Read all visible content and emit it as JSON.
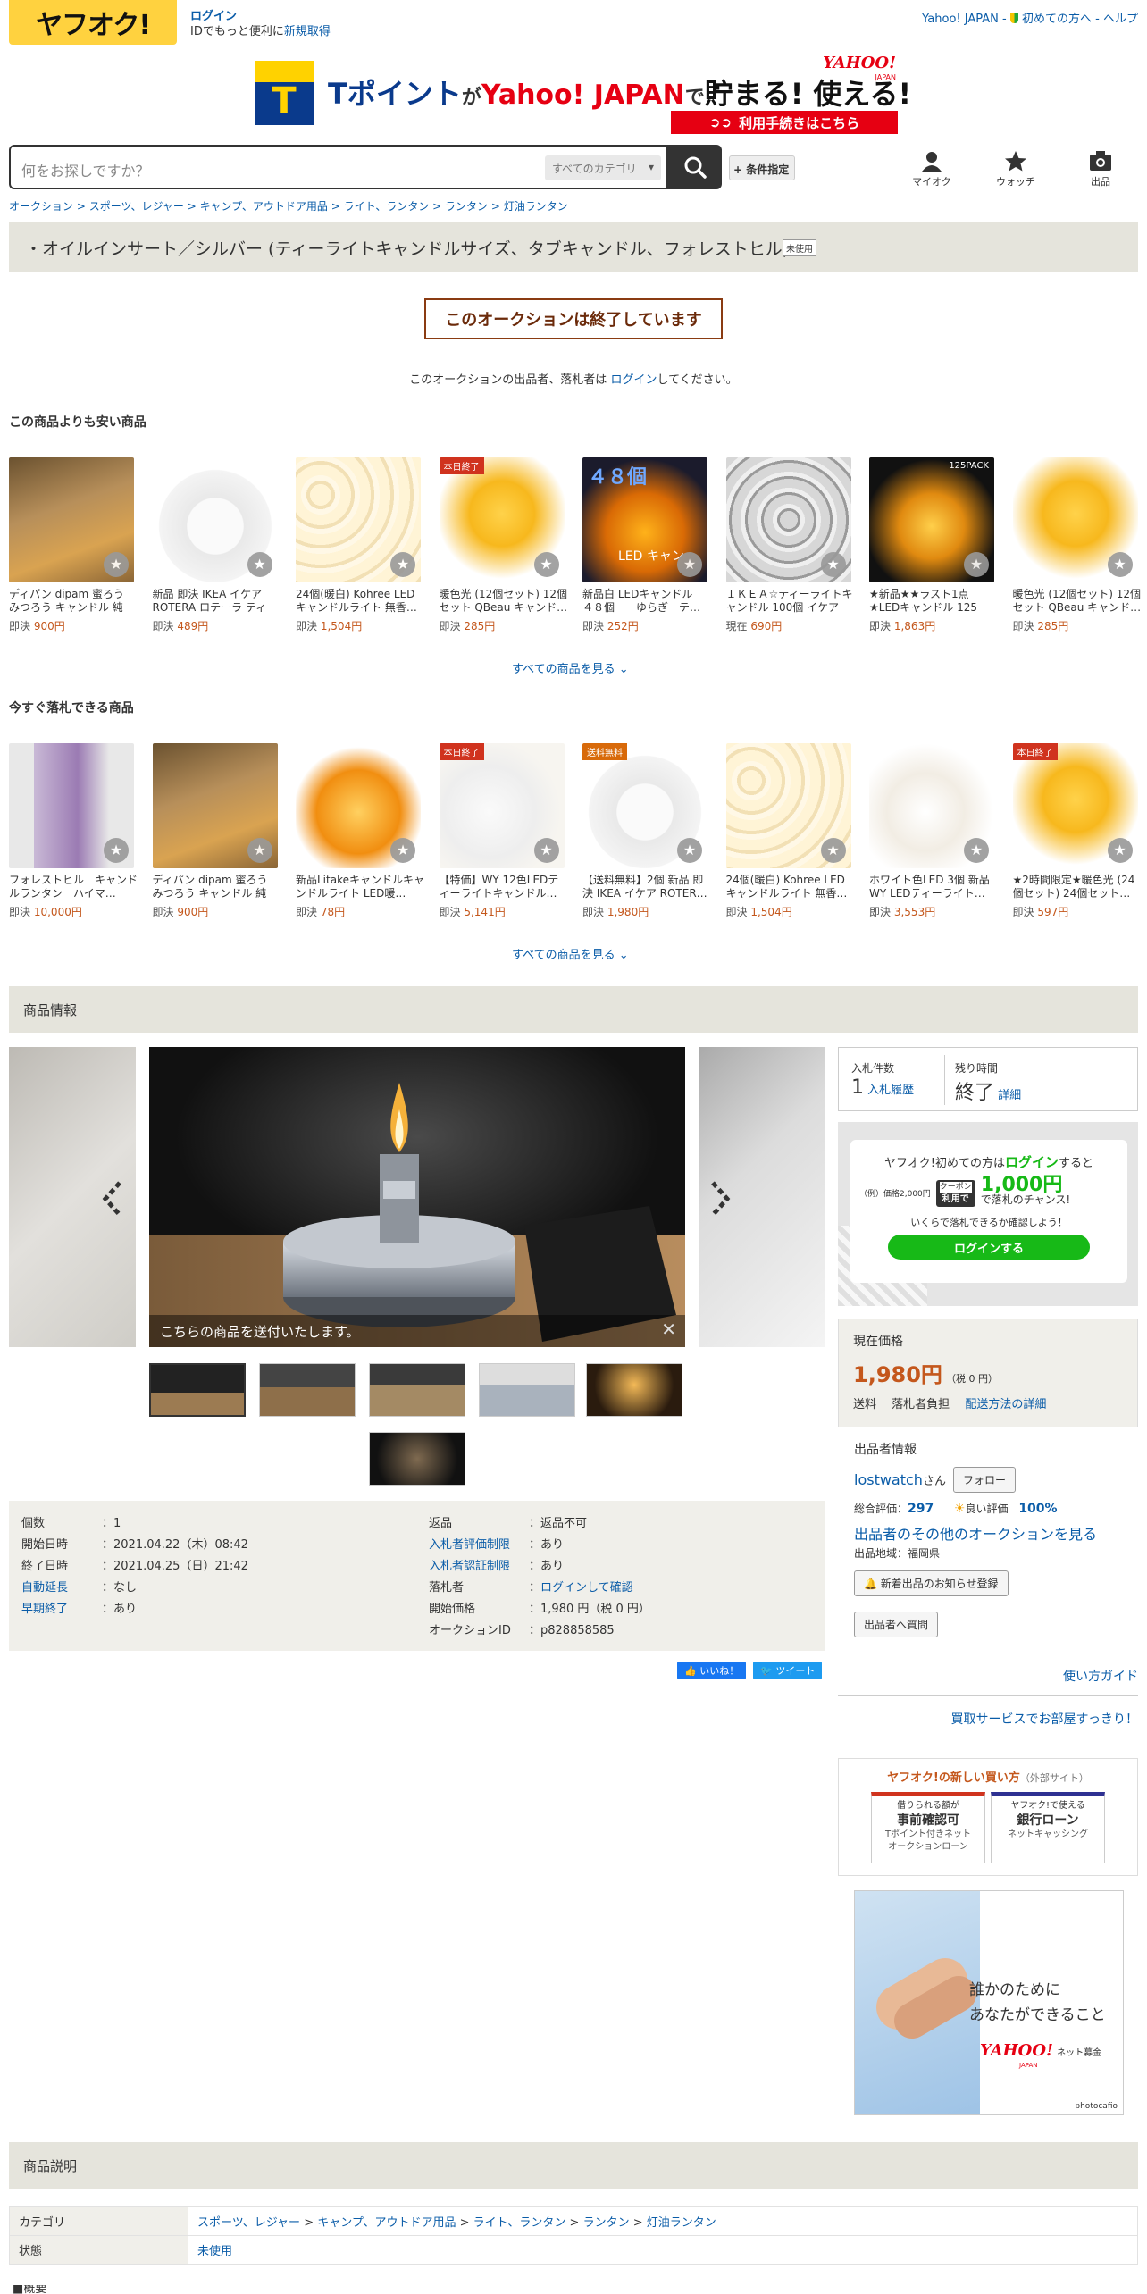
{
  "header": {
    "logo_text": "ヤフオク!",
    "login_label": "ログイン",
    "login_sub_prefix": "IDでもっと便利に",
    "login_sub_link": "新規取得",
    "links": [
      "Yahoo! JAPAN",
      "初めての方へ",
      "ヘルプ"
    ]
  },
  "banner": {
    "t_logo": "T",
    "text_tpoint": "Tポイント",
    "text_ga": "が",
    "text_yahoo": "Yahoo! JAPAN",
    "text_de": "で",
    "text_tamaru": "貯まる! 使える!",
    "corner_logo": "YAHOO!",
    "corner_logo_sub": "JAPAN",
    "cta": "利用手続きはこちら"
  },
  "search": {
    "placeholder": "何をお探しですか？",
    "category": "すべてのカテゴリ",
    "cond_button": "+ 条件指定"
  },
  "nav_icons": [
    {
      "label": "マイオク",
      "icon": "person-icon"
    },
    {
      "label": "ウォッチ",
      "icon": "star-icon"
    },
    {
      "label": "出品",
      "icon": "camera-icon"
    }
  ],
  "breadcrumb": [
    "オークション",
    "スポーツ、レジャー",
    "キャンプ、アウトドア用品",
    "ライト、ランタン",
    "ランタン",
    "灯油ランタン"
  ],
  "title": "・オイルインサート／シルバー (ティーライトキャンドルサイズ、タブキャンドル、フォレストヒル)",
  "condition_badge": "未使用",
  "ended_message": "このオークションは終了しています",
  "ended_note_prefix": "このオークションの出品者、落札者は ",
  "ended_note_link": "ログイン",
  "ended_note_suffix": "してください。",
  "cheaper": {
    "heading": "この商品よりも安い商品",
    "see_all": "すべての商品を見る",
    "items": [
      {
        "name": "ディパン dipam 蜜ろう みつろう キャンドル 純粋…",
        "plabel": "即決",
        "price": "900円",
        "tag": "",
        "img": "wax"
      },
      {
        "name": "新品 即決 IKEA イケア ROTERA ロテーラ ティー…",
        "plabel": "即決",
        "price": "489円",
        "tag": "",
        "img": "lantern"
      },
      {
        "name": "24個(暖白) Kohree LED キャンドルライト 無香…",
        "plabel": "即決",
        "price": "1,504円",
        "tag": "",
        "img": "cream"
      },
      {
        "name": "暖色光 (12個セット) 12個セット QBeau キャンド…",
        "plabel": "即決",
        "price": "285円",
        "tag": "本日終了",
        "img": "tri"
      },
      {
        "name": "新品白 LEDキャンドル　４８個　　ゆらぎ　テ…",
        "plabel": "即決",
        "price": "252円",
        "tag": "",
        "img": "led48"
      },
      {
        "name": "ＩＫＥＡ☆ティーライトキャンドル 100個 イケア",
        "plabel": "現在",
        "price": "690円",
        "tag": "",
        "img": "silver"
      },
      {
        "name": "★新品★★ラスト1点★LEDキャンドル 125 個…",
        "plabel": "即決",
        "price": "1,863円",
        "tag": "",
        "img": "dark125"
      },
      {
        "name": "暖色光 (12個セット) 12個セット QBeau キャンド…",
        "plabel": "即決",
        "price": "285円",
        "tag": "",
        "img": "tri"
      }
    ],
    "img_text_48": "４８個",
    "img_text_led": "LED キャン",
    "img_text_125": "125PACK"
  },
  "buynow": {
    "heading": "今すぐ落札できる商品",
    "see_all": "すべての商品を見る",
    "items": [
      {
        "name": "フォレストヒル　キャンドルランタン　ハイマ…",
        "plabel": "即決",
        "price": "10,000円",
        "tag": "",
        "img": "pack"
      },
      {
        "name": "ディパン dipam 蜜ろう みつろう キャンドル 純粋…",
        "plabel": "即決",
        "price": "900円",
        "tag": "",
        "img": "wax"
      },
      {
        "name": "新品Litakeキャンドルキャンドルライト LED暖…",
        "plabel": "即決",
        "price": "78円",
        "tag": "",
        "img": "heart"
      },
      {
        "name": "【特価】WY 12色LEDティーライトキャンドル…",
        "plabel": "即決",
        "price": "5,141円",
        "tag": "本日終了",
        "img": "remote"
      },
      {
        "name": "【送料無料】2個 新品 即決 IKEA イケア ROTER…",
        "plabel": "即決",
        "price": "1,980円",
        "tag": "送料無料",
        "img": "lantern"
      },
      {
        "name": "24個(暖白) Kohree LED キャンドルライト 無香…",
        "plabel": "即決",
        "price": "1,504円",
        "tag": "",
        "img": "cream"
      },
      {
        "name": "ホワイト色LED 3個 新品 WY LEDティーライト…",
        "plabel": "即決",
        "price": "3,553円",
        "tag": "",
        "img": "white3"
      },
      {
        "name": "★2時間限定★暖色光 (24個セット) 24個セット…",
        "plabel": "即決",
        "price": "597円",
        "tag": "本日終了",
        "img": "tri"
      }
    ]
  },
  "item_info_heading": "商品情報",
  "gallery": {
    "caption": "こちらの商品を送付いたします。",
    "thumb_count": 6
  },
  "details_left": [
    {
      "k": "個数",
      "v": "1",
      "klink": false
    },
    {
      "k": "開始日時",
      "v": "2021.04.22（木）08:42",
      "klink": false
    },
    {
      "k": "終了日時",
      "v": "2021.04.25（日）21:42",
      "klink": false
    },
    {
      "k": "自動延長",
      "v": "なし",
      "klink": true
    },
    {
      "k": "早期終了",
      "v": "あり",
      "klink": true
    }
  ],
  "details_right": [
    {
      "k": "返品",
      "v": "返品不可",
      "klink": false
    },
    {
      "k": "入札者評価制限",
      "v": "あり",
      "klink": true
    },
    {
      "k": "入札者認証制限",
      "v": "あり",
      "klink": true
    },
    {
      "k": "落札者",
      "v": "ログインして確認",
      "klink": false,
      "vlink": true
    },
    {
      "k": "開始価格",
      "v": "1,980 円（税 0 円）",
      "klink": false
    },
    {
      "k": "オークションID",
      "v": "p828858585",
      "klink": false
    }
  ],
  "share": {
    "like": "いいね！",
    "tweet": "ツイート"
  },
  "bid": {
    "count_label": "入札件数",
    "count": "1",
    "history_link": "入札履歴",
    "remain_label": "残り時間",
    "remain": "終了",
    "detail_link": "詳細"
  },
  "promo": {
    "line1_prefix": "ヤフオク!初めての方は",
    "line1_link": "ログイン",
    "line1_suffix": "すると",
    "example": "（例）価格2,000円",
    "coupon_a": "クーポン",
    "coupon_b": "利用で",
    "amount": "1,000円",
    "chance": "で落札のチャンス!",
    "note": "いくらで落札できるか確認しよう！",
    "button": "ログインする"
  },
  "price": {
    "label": "現在価格",
    "value": "1,980円",
    "tax": "（税 0 円）",
    "ship_label": "送料",
    "ship_value": "落札者負担",
    "ship_link": "配送方法の詳細"
  },
  "seller": {
    "heading": "出品者情報",
    "name": "lostwatch",
    "san": "さん",
    "follow": "フォロー",
    "rating_label": "総合評価：",
    "rating": "297",
    "good_label": "良い評価",
    "good": "100%",
    "other_link": "出品者のその他のオークションを見る",
    "region": "出品地域：福岡県",
    "notify_btn": "新着出品のお知らせ登録",
    "ask_btn": "出品者へ質問"
  },
  "guide_link": "使い方ガイド",
  "shop_link": "買取サービスでお部屋すっきり！",
  "newway": {
    "title": "ヤフオク!の新しい買い方",
    "external": "（外部サイト）",
    "card1_top": "借りられる額が",
    "card1_mid": "事前確認可",
    "card1_bot": "Tポイント付きネット\nオークションローン",
    "card2_top": "ヤフオク!で使える",
    "card2_mid": "銀行ローン",
    "card2_bot": "ネットキャッシング"
  },
  "ad": {
    "line1": "誰かのために",
    "line2": "あなたができること",
    "logo": "YAHOO!",
    "logo_sub": "JAPAN",
    "logo_tail": "ネット募金",
    "credit": "photocafio"
  },
  "desc_heading": "商品説明",
  "desc_table": {
    "cat_label": "カテゴリ",
    "cat_path": [
      "スポーツ、レジャー",
      "キャンプ、アウトドア用品",
      "ライト、ランタン",
      "ランタン",
      "灯油ランタン"
    ],
    "state_label": "状態",
    "state_value": "未使用"
  },
  "overview_label": "■概要",
  "colors": {
    "accent": "#ffd23f",
    "link": "#0a5ca8",
    "price": "#c4571c",
    "green": "#17b917",
    "ended": "#8a3b12"
  }
}
